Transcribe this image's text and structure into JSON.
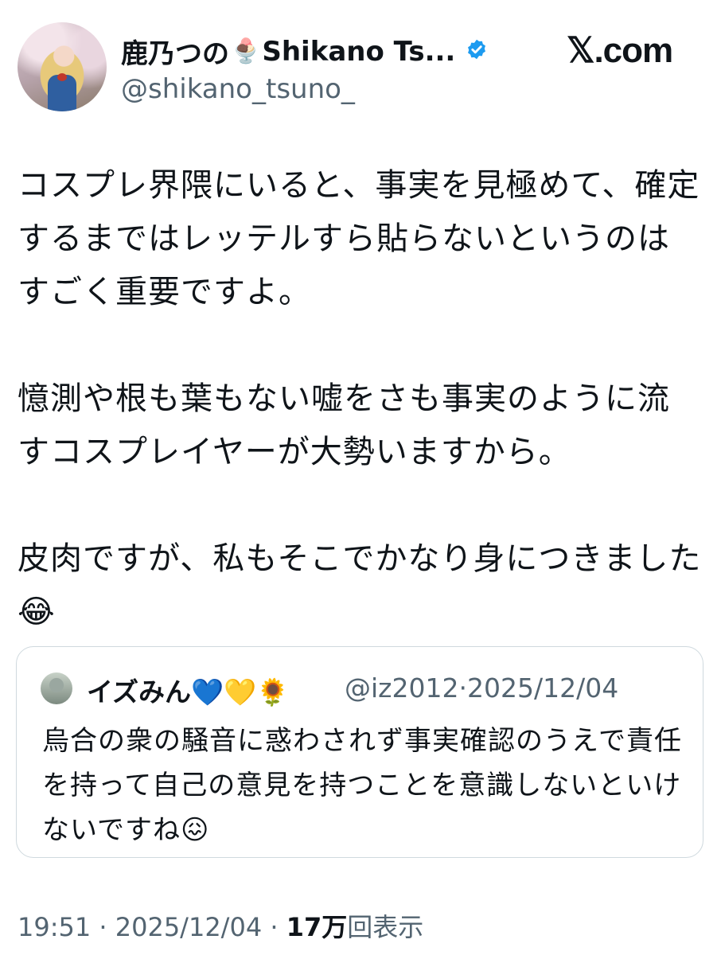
{
  "author": {
    "name": "鹿乃つの",
    "name_emoji": "🍨",
    "name_suffix": "Shikano Ts...",
    "handle": "@shikano_tsuno_",
    "verified": true
  },
  "brand": "𝕏.com",
  "post": {
    "paragraphs": [
      "コスプレ界隈にいると、事実を見極めて、確定するまではレッテルすら貼らないというのはすごく重要ですよ。",
      "憶測や根も葉もない嘘をさも事実のように流すコスプレイヤーが大勢いますから。",
      "皮肉ですが、私もそこでかなり身につきました😂"
    ]
  },
  "quote": {
    "name": "イズみん💙💛🌻",
    "handle": "@iz2012",
    "separator": "·",
    "date": "2025/12/04",
    "text": "烏合の衆の騒音に惑わされず事実確認のうえで責任を持って自己の意見を持つことを意識しないといけないですね😖"
  },
  "meta": {
    "time": "19:51",
    "separator": "·",
    "date": "2025/12/04",
    "views_count": "17万",
    "views_label": "回表示"
  },
  "colors": {
    "text": "#0f1419",
    "secondary": "#536471",
    "verified": "#1d9bf0",
    "border": "#cfd9de"
  },
  "icons": {
    "verified": "verified-badge-icon"
  }
}
